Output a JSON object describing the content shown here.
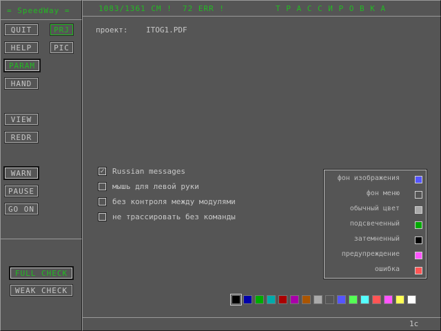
{
  "header": {
    "app_title": "= SpeedWay =",
    "stats": "1083/1361 СМ !  72 ERR !",
    "mode_title": "Т Р А С С И Р О В К А"
  },
  "sidebar": {
    "quit": "QUIT",
    "prj": "PRJ",
    "help": "HELP",
    "pic": "PIC",
    "param": "PARAM",
    "hand": "HAND",
    "view": "VIEW",
    "redr": "REDR",
    "warn": "WARN",
    "pause": "PAUSE",
    "go_on": "GO ON",
    "full_check": "FULL CHECK",
    "weak_check": "WEAK CHECK"
  },
  "main": {
    "project_label": "проект:",
    "project_file": "ITOG1.PDF",
    "options": [
      {
        "label": "Russian messages",
        "checked": true
      },
      {
        "label": "мышь для левой руки",
        "checked": false
      },
      {
        "label": "без контроля между модулями",
        "checked": false
      },
      {
        "label": "не трассировать без команды",
        "checked": false
      }
    ]
  },
  "legend": [
    {
      "label": "фон изображения",
      "color": "#5555ff"
    },
    {
      "label": "фон меню",
      "color": "#555555"
    },
    {
      "label": "обычный цвет",
      "color": "#aaaaaa"
    },
    {
      "label": "подсвеченный",
      "color": "#00aa00"
    },
    {
      "label": "затемненный",
      "color": "#000000"
    },
    {
      "label": "предупреждение",
      "color": "#ff55ff"
    },
    {
      "label": "ошибка",
      "color": "#ff5555"
    }
  ],
  "palette": [
    "#000000",
    "#0000aa",
    "#00aa00",
    "#00aaaa",
    "#aa0000",
    "#aa00aa",
    "#aa5500",
    "#aaaaaa",
    "#555555",
    "#5555ff",
    "#55ff55",
    "#55ffff",
    "#ff5555",
    "#ff55ff",
    "#ffff55",
    "#ffffff"
  ],
  "status": {
    "right_text": "1c"
  }
}
